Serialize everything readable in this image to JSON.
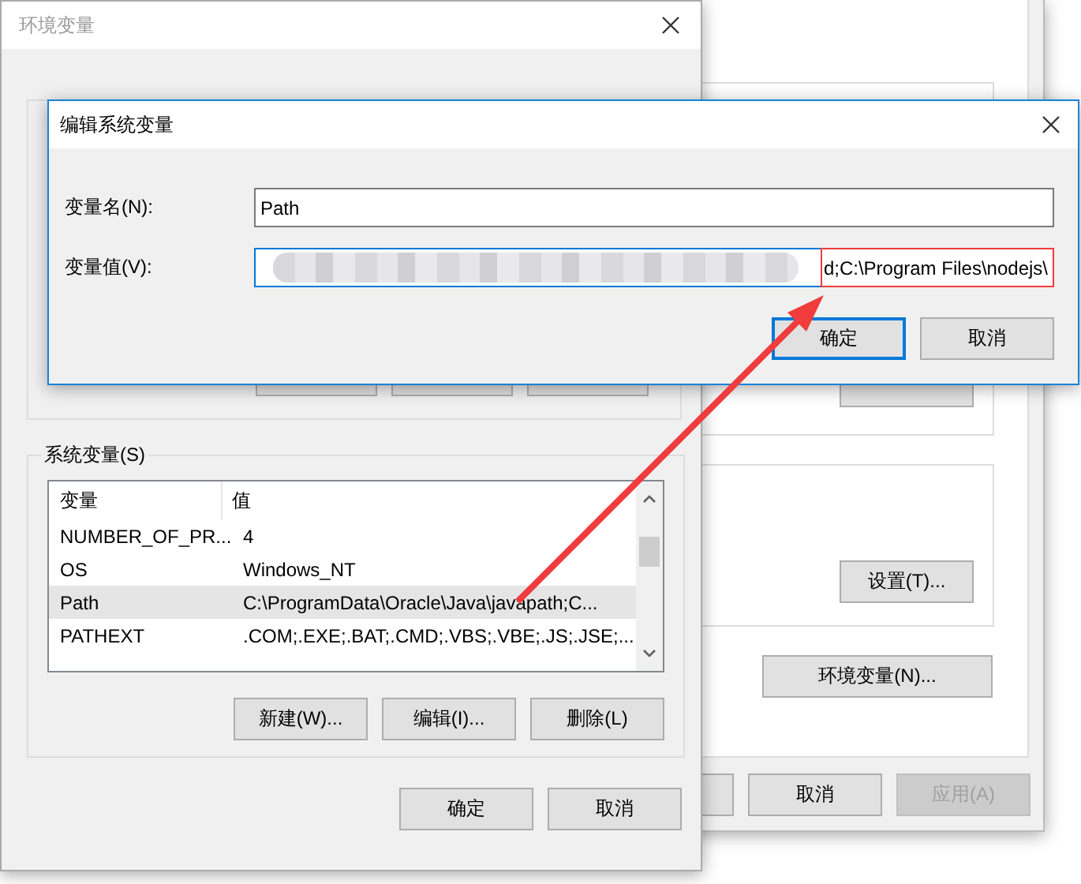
{
  "background_window": {
    "settings_button": {
      "label": "设置(T)..."
    },
    "env_button": {
      "label": "环境变量(N)..."
    },
    "footer_buttons": [
      {
        "label": "取消",
        "disabled": false
      },
      {
        "label": "应用(A)",
        "disabled": true
      }
    ]
  },
  "env_window": {
    "title": "环境变量",
    "system_variables": {
      "title": "系统变量(S)",
      "columns": [
        "变量",
        "值"
      ],
      "rows": [
        {
          "name": "NUMBER_OF_PR...",
          "value": "4",
          "selected": false
        },
        {
          "name": "OS",
          "value": "Windows_NT",
          "selected": false
        },
        {
          "name": "Path",
          "value": "C:\\ProgramData\\Oracle\\Java\\javapath;C...",
          "selected": true
        },
        {
          "name": "PATHEXT",
          "value": ".COM;.EXE;.BAT;.CMD;.VBS;.VBE;.JS;.JSE;...",
          "selected": false
        }
      ]
    },
    "list_buttons": [
      "新建(W)...",
      "编辑(I)...",
      "删除(L)"
    ],
    "footer_buttons": [
      "确定",
      "取消"
    ]
  },
  "edit_dialog": {
    "title": "编辑系统变量",
    "fields": [
      {
        "label": "变量名(N):",
        "value": "Path",
        "focused": false,
        "redacted": false,
        "highlighted": false
      },
      {
        "label": "变量值(V):",
        "value": "d;C:\\Program Files\\nodejs\\",
        "focused": true,
        "redacted": true,
        "highlighted": true
      }
    ],
    "buttons": [
      {
        "label": "确定",
        "default": true
      },
      {
        "label": "取消",
        "default": false
      }
    ]
  }
}
